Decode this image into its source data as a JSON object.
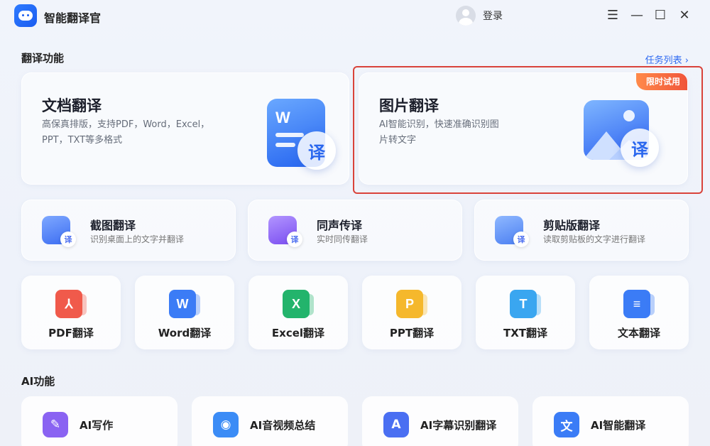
{
  "app": {
    "title": "智能翻译官",
    "login_label": "登录"
  },
  "window_controls": {
    "menu": "☰",
    "minimize": "—",
    "maximize": "☐",
    "close": "✕"
  },
  "sections": {
    "translate": "翻译功能",
    "task_list": "任务列表 ›",
    "ai": "AI功能"
  },
  "feature_cards": [
    {
      "title": "文档翻译",
      "desc": "高保真排版，支持PDF，Word，Excel，PPT，TXT等多格式",
      "badge": "",
      "icon": "document-icon"
    },
    {
      "title": "图片翻译",
      "desc": "AI智能识别，快速准确识别图片转文字",
      "badge": "限时试用",
      "icon": "image-icon"
    }
  ],
  "mid_cards": [
    {
      "title": "截图翻译",
      "desc": "识别桌面上的文字并翻译",
      "icon": "screenshot-icon",
      "color": "#4f7cf7"
    },
    {
      "title": "同声传译",
      "desc": "实时同传翻译",
      "icon": "voice-icon",
      "color": "#8a5cf5"
    },
    {
      "title": "剪贴版翻译",
      "desc": "读取剪贴板的文字进行翻译",
      "icon": "clipboard-icon",
      "color": "#4f8cf7"
    }
  ],
  "format_cards": [
    {
      "label": "PDF翻译",
      "glyph": "⅄",
      "icon": "pdf-icon",
      "color": "#f05a4b"
    },
    {
      "label": "Word翻译",
      "glyph": "W",
      "icon": "word-icon",
      "color": "#3b7cf6"
    },
    {
      "label": "Excel翻译",
      "glyph": "X",
      "icon": "excel-icon",
      "color": "#23b46c"
    },
    {
      "label": "PPT翻译",
      "glyph": "P",
      "icon": "ppt-icon",
      "color": "#f5b82c"
    },
    {
      "label": "TXT翻译",
      "glyph": "T",
      "icon": "txt-icon",
      "color": "#3aa6f0"
    },
    {
      "label": "文本翻译",
      "glyph": "≡",
      "icon": "text-icon",
      "color": "#3b7cf6"
    }
  ],
  "yi_glyph": "译",
  "ai_cards": [
    {
      "label": "AI写作",
      "glyph": "✎",
      "icon": "ai-writing-icon",
      "color": "#8a63f2"
    },
    {
      "label": "AI音视频总结",
      "glyph": "◉",
      "icon": "ai-media-icon",
      "color": "#3b8cf6"
    },
    {
      "label": "AI字幕识别翻译",
      "glyph": "A",
      "icon": "ai-subtitle-icon",
      "color": "#4a6ff2"
    },
    {
      "label": "AI智能翻译",
      "glyph": "文",
      "icon": "ai-translate-icon",
      "color": "#3b7cf6"
    }
  ]
}
